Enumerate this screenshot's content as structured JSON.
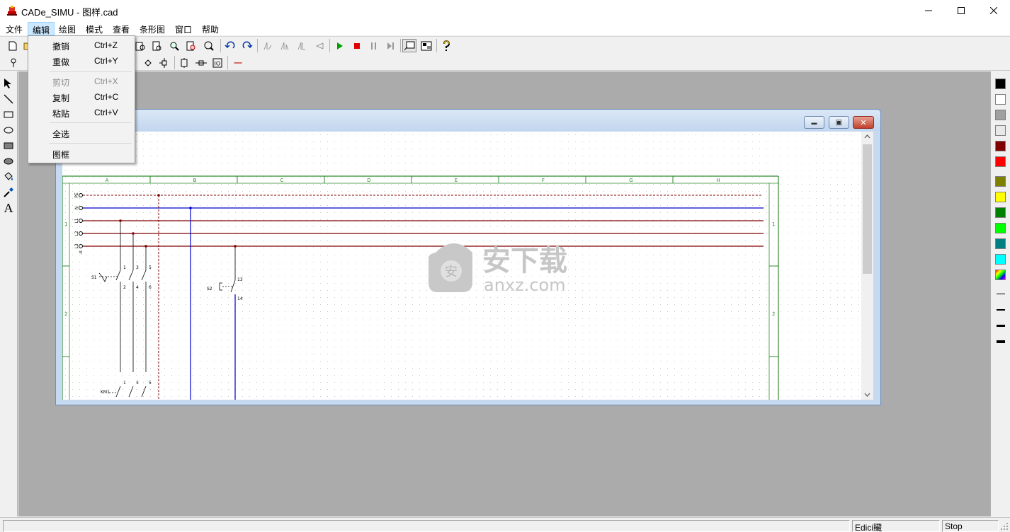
{
  "window": {
    "title": "CADe_SIMU - 图样.cad",
    "minimize_glyph": "—",
    "maximize_glyph": "☐",
    "close_glyph": "✕"
  },
  "menubar": {
    "items": [
      {
        "label": "文件"
      },
      {
        "label": "编辑",
        "active": true
      },
      {
        "label": "绘图"
      },
      {
        "label": "模式"
      },
      {
        "label": "查看"
      },
      {
        "label": "条形图"
      },
      {
        "label": "窗口"
      },
      {
        "label": "帮助"
      }
    ]
  },
  "edit_menu": {
    "items": [
      {
        "label": "撤销",
        "shortcut": "Ctrl+Z",
        "enabled": true
      },
      {
        "label": "重做",
        "shortcut": "Ctrl+Y",
        "enabled": true
      },
      {
        "label": "剪切",
        "shortcut": "Ctrl+X",
        "enabled": false
      },
      {
        "label": "复制",
        "shortcut": "Ctrl+C",
        "enabled": true
      },
      {
        "label": "粘贴",
        "shortcut": "Ctrl+V",
        "enabled": true
      },
      {
        "label": "全选",
        "shortcut": "",
        "enabled": true
      },
      {
        "label": "图框",
        "shortcut": "",
        "enabled": true
      }
    ]
  },
  "toolbar": {
    "icons": [
      "new-file-icon",
      "open-icon",
      "print-preview-icon",
      "print-icon",
      "zoom-icon",
      "find-icon",
      "symbol-icon",
      "undo-icon",
      "redo-icon",
      "align-icon",
      "mirror-icon",
      "flip-icon",
      "rotate-icon",
      "play-icon",
      "stop-icon",
      "pause-icon",
      "step-icon",
      "view-window-icon",
      "view-layout-icon",
      "help-icon"
    ],
    "colors": {
      "play": "#00a000",
      "stop": "#e00000",
      "help": "#c8a000"
    }
  },
  "toolbar2": {
    "icons": [
      "pin-icon",
      "diamond-icon",
      "terminal-icon",
      "label-icon",
      "connector-icon",
      "io-icon",
      "red-line-icon"
    ],
    "red_line_glyph": "—"
  },
  "left_tools": {
    "icons": [
      "arrow-select-icon",
      "line-icon",
      "rectangle-icon",
      "ellipse-icon",
      "filled-rectangle-icon",
      "filled-ellipse-icon",
      "fill-bucket-icon",
      "dropper-icon",
      "text-icon"
    ],
    "text_tool_glyph": "A"
  },
  "color_palette": {
    "colors": [
      "#000000",
      "#ffffff",
      "#a0a0a0",
      "#e8e8e8",
      "#800000",
      "#ff0000",
      "#808000",
      "#ffff00",
      "#008000",
      "#00ff00",
      "#008080",
      "#00ffff",
      "rainbow"
    ],
    "line_widths": [
      1,
      2,
      3,
      4
    ]
  },
  "child_window": {
    "minimize_glyph": "▬",
    "restore_glyph": "▣",
    "close_glyph": "✕"
  },
  "schematic": {
    "column_labels": [
      "A",
      "B",
      "C",
      "D",
      "E",
      "F",
      "G",
      "H"
    ],
    "row_labels": [
      "1",
      "2"
    ],
    "bus_labels": [
      "PE",
      "N",
      "L1",
      "L2",
      "L3"
    ],
    "bus_suffix": "-X",
    "colors": {
      "frame": "#2e8b2e",
      "pe": "#800000",
      "n": "#0000cc",
      "phase": "#800000",
      "grid_dot": "#c8c8c8"
    },
    "labels": {
      "s1": "S1",
      "s1_pins_top": [
        "1",
        "3",
        "5"
      ],
      "s1_pins_bottom": [
        "2",
        "4",
        "6"
      ],
      "s2": "S2",
      "s2_pin_top": "13",
      "s2_pin_bottom": "14",
      "km1": "KM1",
      "km1_pins_top": [
        "1",
        "3",
        "5"
      ]
    }
  },
  "watermark": {
    "main": "安下载",
    "sub": "anxz.com",
    "badge": "安"
  },
  "statusbar": {
    "mode": "Edici贜",
    "sim_state": "Stop"
  }
}
